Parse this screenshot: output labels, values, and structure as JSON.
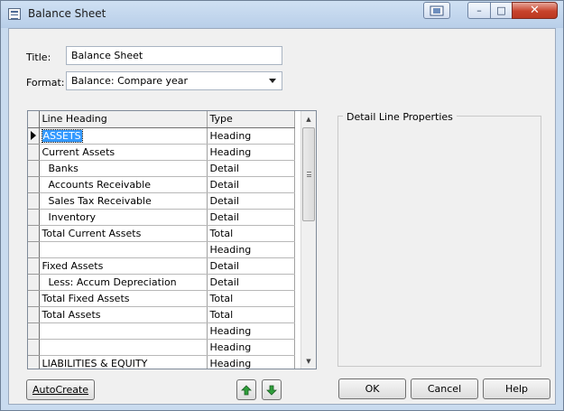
{
  "window": {
    "title": "Balance Sheet",
    "controls": {
      "help_icon": "help-icon",
      "minimize": "–",
      "maximize": "□",
      "close": "✕"
    }
  },
  "form": {
    "title_label": "Title:",
    "title_value": "Balance Sheet",
    "format_label": "Format:",
    "format_value": "Balance: Compare year"
  },
  "grid": {
    "columns": [
      "Line Heading",
      "Type"
    ],
    "rows": [
      {
        "heading": "ASSETS",
        "type": "Heading",
        "selected": true
      },
      {
        "heading": "Current Assets",
        "type": "Heading"
      },
      {
        "heading": "  Banks",
        "type": "Detail"
      },
      {
        "heading": "  Accounts Receivable",
        "type": "Detail"
      },
      {
        "heading": "  Sales Tax Receivable",
        "type": "Detail"
      },
      {
        "heading": "  Inventory",
        "type": "Detail"
      },
      {
        "heading": "Total Current Assets",
        "type": "Total"
      },
      {
        "heading": "",
        "type": "Heading"
      },
      {
        "heading": "Fixed Assets",
        "type": "Detail"
      },
      {
        "heading": "  Less: Accum Depreciation",
        "type": "Detail"
      },
      {
        "heading": "Total Fixed Assets",
        "type": "Total"
      },
      {
        "heading": "Total Assets",
        "type": "Total"
      },
      {
        "heading": "",
        "type": "Heading"
      },
      {
        "heading": "",
        "type": "Heading"
      },
      {
        "heading": "LIABILITIES & EQUITY",
        "type": "Heading"
      }
    ]
  },
  "detail_group": {
    "title": "Detail Line Properties"
  },
  "buttons": {
    "autocreate": "AutoCreate",
    "move_up": "arrow-up-icon",
    "move_down": "arrow-down-icon",
    "ok": "OK",
    "cancel": "Cancel",
    "help": "Help"
  },
  "colors": {
    "selection": "#3399ff",
    "arrow_green": "#2e9e3a"
  }
}
